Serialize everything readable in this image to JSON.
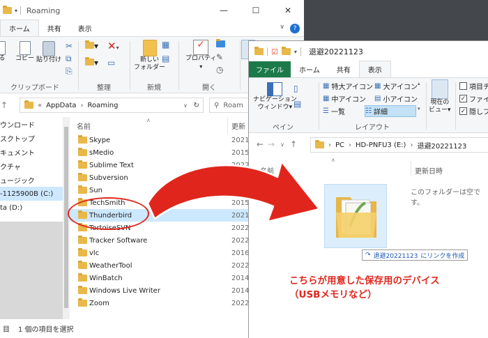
{
  "left_window": {
    "title": "Roaming",
    "tabs": [
      "ホーム",
      "共有",
      "表示"
    ],
    "ribbon": {
      "clipboard_buttons": [
        "る",
        "コピー",
        "貼り付け"
      ],
      "groups": [
        "クリップボード",
        "整理",
        "新規",
        "開く"
      ],
      "new_folder_label_1": "新しい",
      "new_folder_label_2": "フォルダー",
      "properties_label": "プロパティ"
    },
    "address": {
      "part1": "AppData",
      "part2": "Roaming"
    },
    "search_placeholder": "Roam",
    "nav_items": [
      "ウンロード",
      "スクトップ",
      "キュメント",
      "クチャ",
      "ュージック",
      "-1125900B (C:)",
      "ta (D:)"
    ],
    "columns": {
      "name": "名前",
      "date": "更新"
    },
    "files": [
      {
        "name": "Skype",
        "date": "2021/"
      },
      {
        "name": "sMedio",
        "date": "2015/"
      },
      {
        "name": "Sublime Text",
        "date": "2022/"
      },
      {
        "name": "Subversion",
        "date": "2021/"
      },
      {
        "name": "Sun",
        "date": "2022/"
      },
      {
        "name": "TechSmith",
        "date": "2015/"
      },
      {
        "name": "Thunderbird",
        "date": "2021/"
      },
      {
        "name": "TortoiseSVN",
        "date": "2022/"
      },
      {
        "name": "Tracker Software",
        "date": "2022/"
      },
      {
        "name": "vlc",
        "date": "2016/"
      },
      {
        "name": "WeatherTool",
        "date": "2022/"
      },
      {
        "name": "WinBatch",
        "date": "2014/"
      },
      {
        "name": "Windows Live Writer",
        "date": "2014/"
      },
      {
        "name": "Zoom",
        "date": "2022/"
      }
    ],
    "status": {
      "count_prefix": "目",
      "selected": "1 個の項目を選択"
    }
  },
  "right_window": {
    "title": "退避20221123",
    "tabs": [
      "ファイル",
      "ホーム",
      "共有",
      "表示"
    ],
    "ribbon": {
      "nav_pane_1": "ナビゲーション",
      "nav_pane_2": "ウィンドウ",
      "pane_group": "ペイン",
      "layout_group": "レイアウト",
      "layout_items": [
        "特大アイコン",
        "大アイコン",
        "中アイコン",
        "小アイコン",
        "一覧",
        "詳細"
      ],
      "current_view_1": "現在の",
      "current_view_2": "ビュー",
      "checkbox_items": [
        "項目チ",
        "ファイル",
        "隠しフ"
      ]
    },
    "address": {
      "pc": "PC",
      "drive": "HD-PNFU3 (E:)",
      "folder": "退避20221123"
    },
    "columns": {
      "name": "名前",
      "date": "更新日時"
    },
    "empty_message": "このフォルダーは空です。",
    "drag_tip": {
      "name": "退避20221123",
      "action": "にリンクを作成"
    },
    "annotation_line1": "こちらが用意した保存用のデバイス",
    "annotation_line2": "（USBメモリなど）"
  },
  "colors": {
    "accent_red": "#e0261c",
    "file_tab_green": "#1c7a4a",
    "selection_blue": "#cce8ff"
  }
}
